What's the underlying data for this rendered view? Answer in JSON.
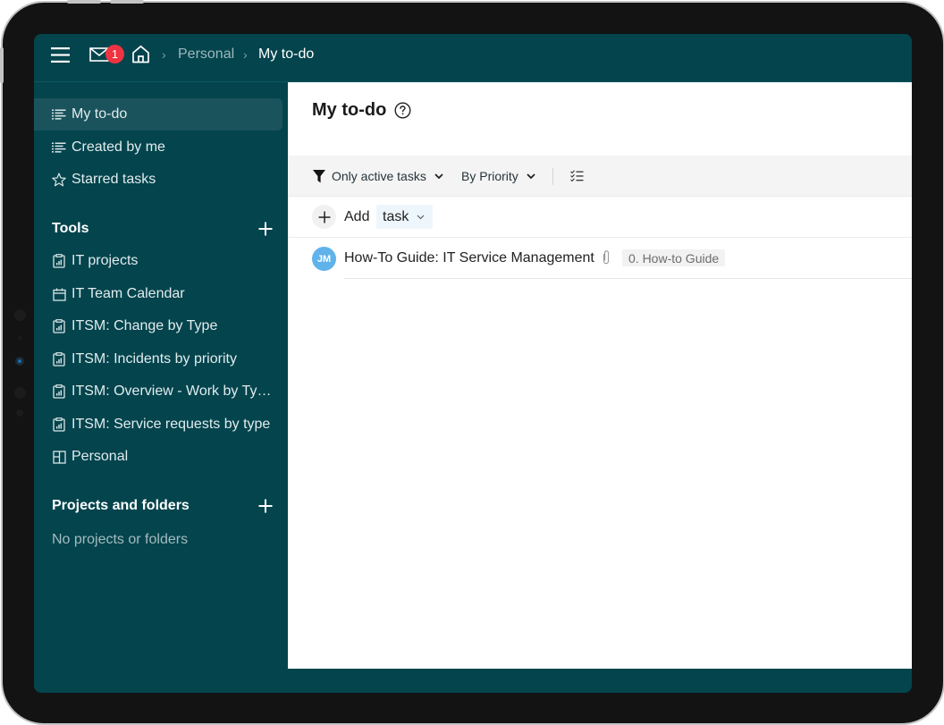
{
  "header": {
    "notification_count": "1",
    "breadcrumb": [
      {
        "label": "Personal"
      },
      {
        "label": "My to-do"
      }
    ]
  },
  "sidebar": {
    "quick_items": [
      {
        "label": "My to-do",
        "icon": "task-list-icon",
        "active": true
      },
      {
        "label": "Created by me",
        "icon": "task-list-icon",
        "active": false
      },
      {
        "label": "Starred tasks",
        "icon": "star-icon",
        "active": false
      }
    ],
    "tools_title": "Tools",
    "tools": [
      {
        "label": "IT projects",
        "icon": "report-clipboard-icon"
      },
      {
        "label": "IT Team Calendar",
        "icon": "calendar-icon"
      },
      {
        "label": "ITSM: Change by Type",
        "icon": "report-clipboard-icon"
      },
      {
        "label": "ITSM: Incidents by priority",
        "icon": "report-clipboard-icon"
      },
      {
        "label": "ITSM: Overview - Work by Ty…",
        "icon": "report-clipboard-icon"
      },
      {
        "label": "ITSM: Service requests by type",
        "icon": "report-clipboard-icon"
      },
      {
        "label": "Personal",
        "icon": "dashboard-layout-icon"
      }
    ],
    "projects_title": "Projects and folders",
    "projects_empty": "No projects or folders"
  },
  "main": {
    "title": "My to-do",
    "toolbar": {
      "filter_label": "Only active tasks",
      "sort_label": "By Priority"
    },
    "add_row": {
      "add_label": "Add",
      "type_value": "task"
    },
    "tasks": [
      {
        "assignee_initials": "JM",
        "title": "How-To Guide: IT Service Management",
        "has_attachment": true,
        "tag": "0. How-to Guide"
      }
    ]
  },
  "colors": {
    "brand_dark_teal": "#04444d",
    "active_item": "#1a535b",
    "badge_red": "#ef3340",
    "avatar_blue": "#5fb3ea"
  }
}
